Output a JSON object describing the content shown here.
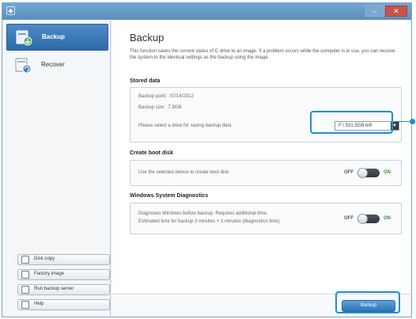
{
  "titlebar": {
    "minimize_label": "–",
    "close_label": "✕"
  },
  "sidebar": {
    "items": [
      {
        "label": "Backup",
        "icon": "backup-icon",
        "active": true
      },
      {
        "label": "Recover",
        "icon": "recover-icon",
        "active": false
      }
    ],
    "tools": [
      {
        "label": "Disk copy",
        "icon": "disk-copy-icon"
      },
      {
        "label": "Factory image",
        "icon": "factory-image-icon"
      },
      {
        "label": "Run backup server",
        "icon": "backup-server-icon"
      },
      {
        "label": "Help",
        "icon": "help-icon"
      }
    ]
  },
  "main": {
    "title": "Backup",
    "description": "This function saves the current status of C drive to an image. If a problem occurs while the computer is in use, you can recover the system to the identical settings as the backup using the image.",
    "stored_data": {
      "label": "Stored data",
      "backup_point": "Backup point : 07/14/2012",
      "backup_size": "Backup size : 7.9GB",
      "select_prompt": "Please select a drive for saving backup data",
      "drive_selected": "F:\\ 931.5GB left"
    },
    "boot_disk": {
      "label": "Create boot disk",
      "text": "Use the selected device to create boot disk",
      "off_label": "OFF",
      "on_label": "ON"
    },
    "diagnostics": {
      "label": "Windows System Diagnostics",
      "line1": "Diagnoses Windows before backup. Requires additional time.",
      "line2": "Estimated time for backup 3 minutes + 2 minutes (diagnostics time)",
      "off_label": "OFF",
      "on_label": "ON"
    },
    "action_button": "Backup"
  },
  "colors": {
    "accent": "#1d8fd1",
    "active_nav": "#2f6aa8"
  }
}
